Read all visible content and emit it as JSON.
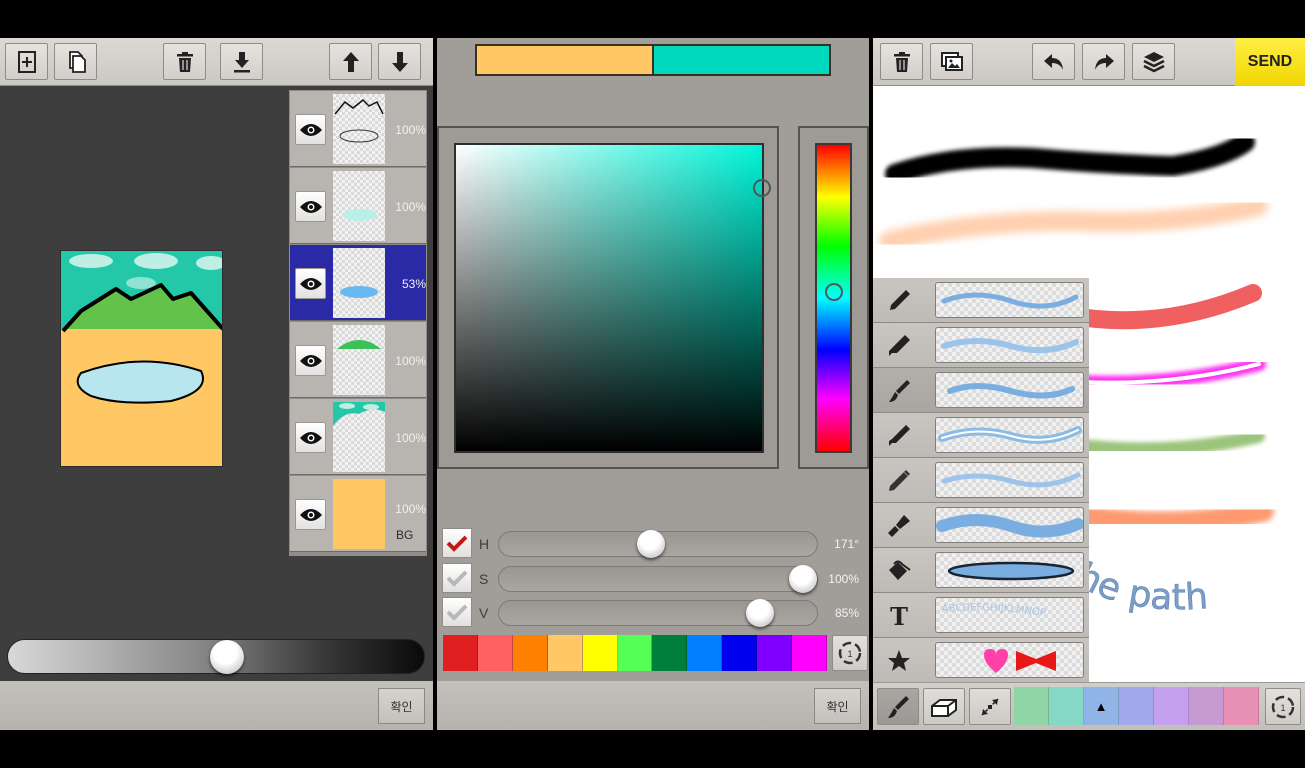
{
  "layer_screen": {
    "toolbar": {
      "buttons": [
        {
          "name": "add-layer-button",
          "icon": "add-layer-icon"
        },
        {
          "name": "duplicate-layer-button",
          "icon": "duplicate-icon"
        },
        {
          "name": "delete-layer-button",
          "icon": "trash-icon"
        },
        {
          "name": "merge-down-button",
          "icon": "merge-down-icon"
        },
        {
          "name": "move-up-button",
          "icon": "arrow-up-icon"
        },
        {
          "name": "move-down-button",
          "icon": "arrow-down-icon"
        }
      ]
    },
    "layers": [
      {
        "opacity": "100%",
        "content": "outline-lines",
        "selected": false
      },
      {
        "opacity": "100%",
        "content": "light-cyan-oval",
        "selected": false
      },
      {
        "opacity": "53%",
        "content": "blue-oval",
        "selected": true
      },
      {
        "opacity": "100%",
        "content": "green-grass",
        "selected": false
      },
      {
        "opacity": "100%",
        "content": "teal-sky",
        "selected": false
      },
      {
        "opacity": "100%",
        "content": "orange-background",
        "selected": false,
        "label": "BG"
      }
    ],
    "opacity_slider_value": 0.53,
    "confirm_label": "확인"
  },
  "color_screen": {
    "previous_color": "#ffc864",
    "current_color": "#00d9be",
    "hue_value": 171,
    "hsv": [
      {
        "label": "H",
        "value": "171°",
        "checked": true,
        "fraction": 0.475
      },
      {
        "label": "S",
        "value": "100%",
        "checked": false,
        "fraction": 1.0
      },
      {
        "label": "V",
        "value": "85%",
        "checked": false,
        "fraction": 0.85
      }
    ],
    "palette": [
      "#e02020",
      "#ff6060",
      "#ff7f00",
      "#ffc864",
      "#ffff00",
      "#55ff55",
      "#007f3a",
      "#0080ff",
      "#0000ee",
      "#7f00ff",
      "#ff00ff"
    ],
    "palette_page": "1",
    "confirm_label": "확인"
  },
  "brush_screen": {
    "toolbar": {
      "buttons": [
        {
          "name": "clear-button",
          "icon": "trash-icon"
        },
        {
          "name": "gallery-button",
          "icon": "gallery-icon"
        },
        {
          "name": "undo-button",
          "icon": "undo-icon"
        },
        {
          "name": "redo-button",
          "icon": "redo-icon"
        },
        {
          "name": "layers-button",
          "icon": "layers-icon"
        }
      ],
      "send_label": "SEND"
    },
    "canvas_text": "the path",
    "brushes": [
      {
        "name": "pen",
        "icon": "pen-icon",
        "selected": false
      },
      {
        "name": "marker",
        "icon": "marker-icon",
        "selected": false
      },
      {
        "name": "brush",
        "icon": "paintbrush-icon",
        "selected": true
      },
      {
        "name": "glow-pen",
        "icon": "glow-pen-icon",
        "selected": false
      },
      {
        "name": "pencil",
        "icon": "pencil-icon",
        "selected": false
      },
      {
        "name": "wide-brush",
        "icon": "wide-brush-icon",
        "selected": false
      },
      {
        "name": "fill-shape",
        "icon": "paint-bucket-icon",
        "selected": false
      },
      {
        "name": "text",
        "icon": "text-icon",
        "selected": false,
        "preview_text": "ABCDEFGHIJKLMNOP"
      },
      {
        "name": "stamp",
        "icon": "star-icon",
        "selected": false
      }
    ],
    "bottom_tools": [
      {
        "name": "brush-tool",
        "icon": "paintbrush-icon",
        "active": true
      },
      {
        "name": "eraser-tool",
        "icon": "eraser-icon",
        "active": false
      },
      {
        "name": "size-tool",
        "icon": "resize-icon",
        "active": false
      }
    ],
    "palette": [
      "#8fd6a4",
      "#86d8c6",
      "#90b4e6",
      "#a2a8ec",
      "#c4a0ee",
      "#c49ad0",
      "#e890b4"
    ],
    "selected_palette_index": 2,
    "selected_marker": "▲",
    "palette_page": "1"
  }
}
